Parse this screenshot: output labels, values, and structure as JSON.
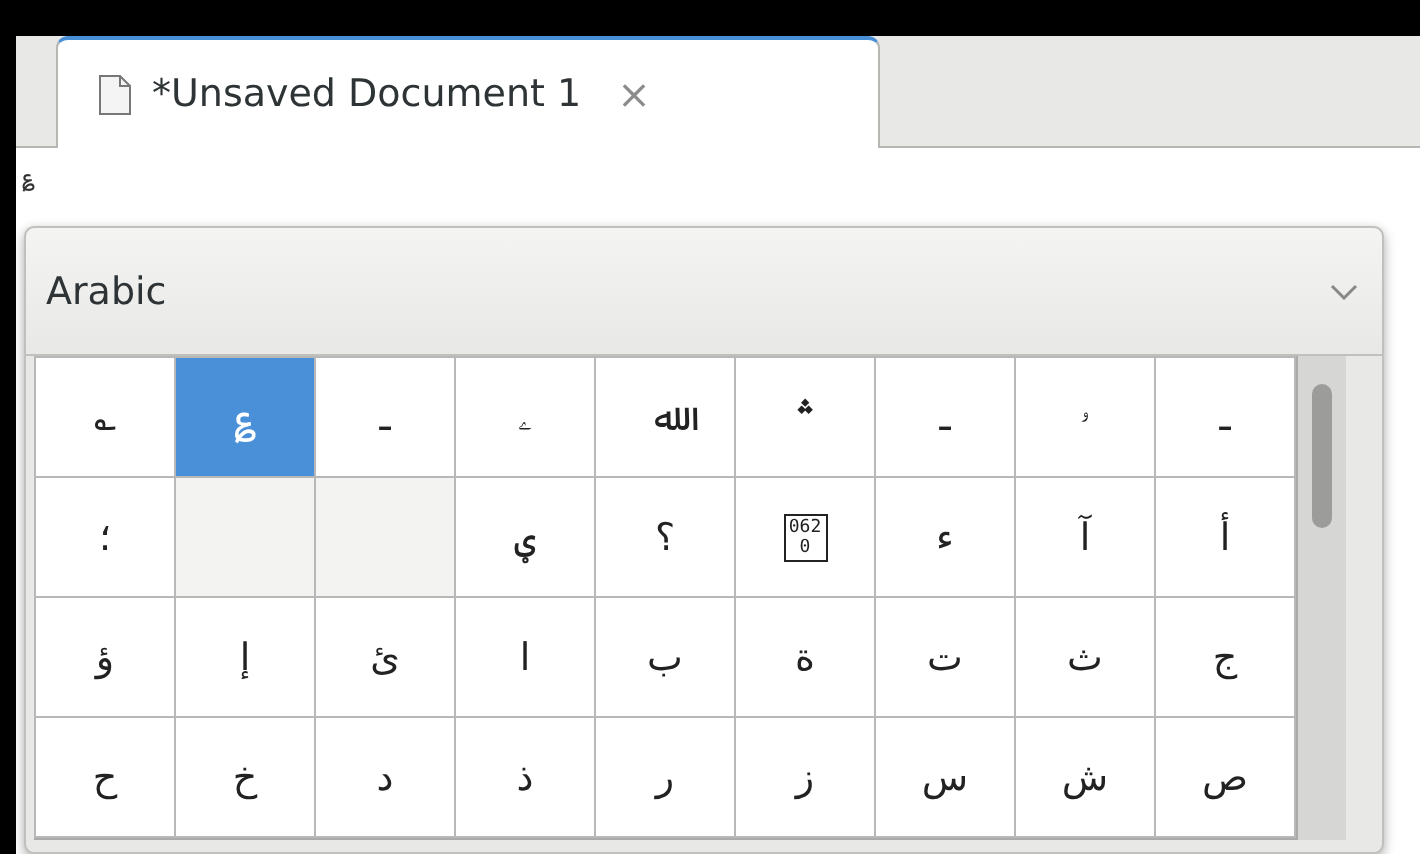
{
  "tab": {
    "title": "*Unsaved Document 1",
    "close": "×",
    "selected": true
  },
  "editor": {
    "text": "؏"
  },
  "dropdown": {
    "value": "Arabic"
  },
  "grid": {
    "rows": [
      [
        {
          "kind": "glyph",
          "char": "؎",
          "selected": false
        },
        {
          "kind": "glyph",
          "char": "؏",
          "selected": true
        },
        {
          "kind": "glyph",
          "char": "ـ",
          "selected": false
        },
        {
          "kind": "glyph",
          "char": "ۦ",
          "selected": false
        },
        {
          "kind": "glyph",
          "char": "ﷲ",
          "selected": false
        },
        {
          "kind": "glyph",
          "char": "؞",
          "selected": false
        },
        {
          "kind": "glyph",
          "char": "ـ",
          "selected": false
        },
        {
          "kind": "glyph",
          "char": "ۥ",
          "selected": false
        },
        {
          "kind": "glyph",
          "char": "ـ",
          "selected": false
        }
      ],
      [
        {
          "kind": "glyph",
          "char": "؛",
          "selected": false
        },
        {
          "kind": "empty",
          "selected": false
        },
        {
          "kind": "empty",
          "selected": false
        },
        {
          "kind": "glyph",
          "char": "ؠ",
          "selected": false
        },
        {
          "kind": "glyph",
          "char": "؟",
          "selected": false
        },
        {
          "kind": "missing",
          "char": "0620",
          "selected": false
        },
        {
          "kind": "glyph",
          "char": "ء",
          "selected": false
        },
        {
          "kind": "glyph",
          "char": "آ",
          "selected": false
        },
        {
          "kind": "glyph",
          "char": "أ",
          "selected": false
        }
      ],
      [
        {
          "kind": "glyph",
          "char": "ؤ",
          "selected": false
        },
        {
          "kind": "glyph",
          "char": "إ",
          "selected": false
        },
        {
          "kind": "glyph",
          "char": "ئ",
          "selected": false
        },
        {
          "kind": "glyph",
          "char": "ا",
          "selected": false
        },
        {
          "kind": "glyph",
          "char": "ب",
          "selected": false
        },
        {
          "kind": "glyph",
          "char": "ة",
          "selected": false
        },
        {
          "kind": "glyph",
          "char": "ت",
          "selected": false
        },
        {
          "kind": "glyph",
          "char": "ث",
          "selected": false
        },
        {
          "kind": "glyph",
          "char": "ج",
          "selected": false
        }
      ],
      [
        {
          "kind": "glyph",
          "char": "ح",
          "selected": false
        },
        {
          "kind": "glyph",
          "char": "خ",
          "selected": false
        },
        {
          "kind": "glyph",
          "char": "د",
          "selected": false
        },
        {
          "kind": "glyph",
          "char": "ذ",
          "selected": false
        },
        {
          "kind": "glyph",
          "char": "ر",
          "selected": false
        },
        {
          "kind": "glyph",
          "char": "ز",
          "selected": false
        },
        {
          "kind": "glyph",
          "char": "س",
          "selected": false
        },
        {
          "kind": "glyph",
          "char": "ش",
          "selected": false
        },
        {
          "kind": "glyph",
          "char": "ص",
          "selected": false
        }
      ]
    ]
  }
}
